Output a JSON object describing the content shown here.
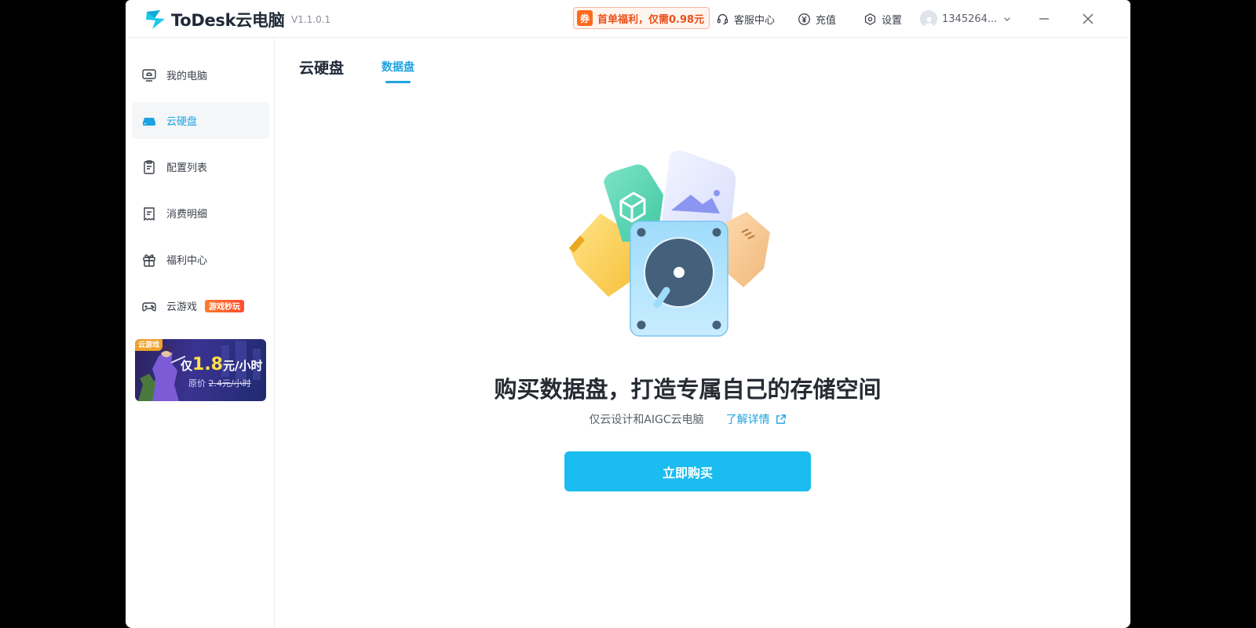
{
  "app": {
    "brand": "ToDesk云电脑",
    "version": "V1.1.0.1"
  },
  "titlebar": {
    "promo_badge": "券",
    "promo_text": "首单福利，仅需0.98元",
    "support": "客服中心",
    "recharge": "充值",
    "settings": "设置",
    "account": "1345264..."
  },
  "sidebar": {
    "items": [
      {
        "label": "我的电脑",
        "icon": "monitor-icon"
      },
      {
        "label": "云硬盘",
        "icon": "disk-icon"
      },
      {
        "label": "配置列表",
        "icon": "clipboard-icon"
      },
      {
        "label": "消费明细",
        "icon": "receipt-icon"
      },
      {
        "label": "福利中心",
        "icon": "gift-icon"
      },
      {
        "label": "云游戏",
        "icon": "gamepad-icon"
      }
    ],
    "game_tag": "游戏秒玩",
    "banner": {
      "tag": "云游戏",
      "prefix": "仅",
      "price": "1.8",
      "unit": "元/小时",
      "original_label": "原价",
      "original_price": "2.4元/小时"
    }
  },
  "main": {
    "tabs": [
      {
        "label": "云硬盘"
      },
      {
        "label": "数据盘"
      }
    ],
    "headline": "购买数据盘，打造专属自己的存储空间",
    "subtext": "仅云设计和AIGC云电脑",
    "learn_more": "了解详情",
    "buy_button": "立即购买"
  },
  "colors": {
    "accent": "#1ea3e0",
    "button": "#1bbcef",
    "promo": "#ff6a1a"
  }
}
